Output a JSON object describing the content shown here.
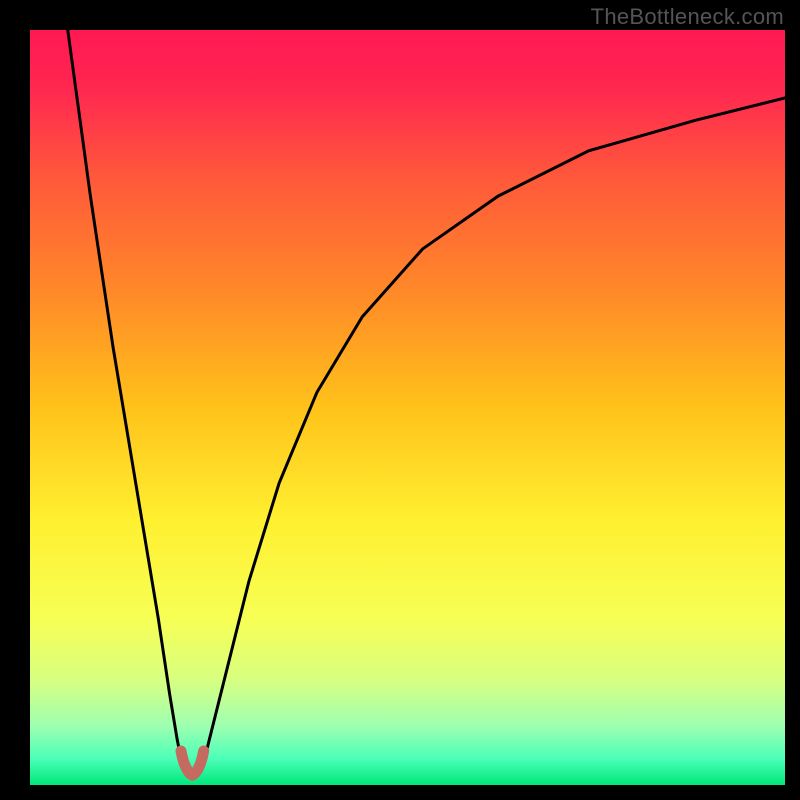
{
  "watermark": "TheBottleneck.com",
  "chart_data": {
    "type": "line",
    "title": "",
    "xlabel": "",
    "ylabel": "",
    "xlim": [
      0,
      100
    ],
    "ylim": [
      0,
      100
    ],
    "gradient_stops": [
      {
        "pos": 0.0,
        "color": "#ff1852"
      },
      {
        "pos": 0.08,
        "color": "#ff2850"
      },
      {
        "pos": 0.2,
        "color": "#ff5a3a"
      },
      {
        "pos": 0.35,
        "color": "#ff8a28"
      },
      {
        "pos": 0.5,
        "color": "#ffc21a"
      },
      {
        "pos": 0.65,
        "color": "#fff030"
      },
      {
        "pos": 0.78,
        "color": "#f7ff55"
      },
      {
        "pos": 0.86,
        "color": "#d8ff80"
      },
      {
        "pos": 0.92,
        "color": "#a0ffb0"
      },
      {
        "pos": 0.965,
        "color": "#4cffb8"
      },
      {
        "pos": 1.0,
        "color": "#00e87a"
      }
    ],
    "series": [
      {
        "name": "left-branch",
        "x": [
          5,
          8,
          11,
          14,
          17,
          18.5,
          19.5,
          20.2,
          20.8
        ],
        "y": [
          100,
          78,
          58,
          40,
          22,
          12,
          6,
          2.5,
          1.2
        ]
      },
      {
        "name": "right-branch",
        "x": [
          22.2,
          23,
          24,
          26,
          29,
          33,
          38,
          44,
          52,
          62,
          74,
          88,
          100
        ],
        "y": [
          1.2,
          3,
          7,
          15,
          27,
          40,
          52,
          62,
          71,
          78,
          84,
          88,
          91
        ]
      },
      {
        "name": "valley-marker",
        "type": "highlight",
        "color": "#c46a60",
        "x": [
          20.0,
          20.5,
          21.5,
          22.5,
          23.0,
          21.5,
          20.0
        ],
        "y": [
          4.5,
          1.8,
          1.3,
          1.8,
          4.5,
          3.2,
          4.5
        ]
      }
    ],
    "legend": [],
    "annotations": []
  }
}
